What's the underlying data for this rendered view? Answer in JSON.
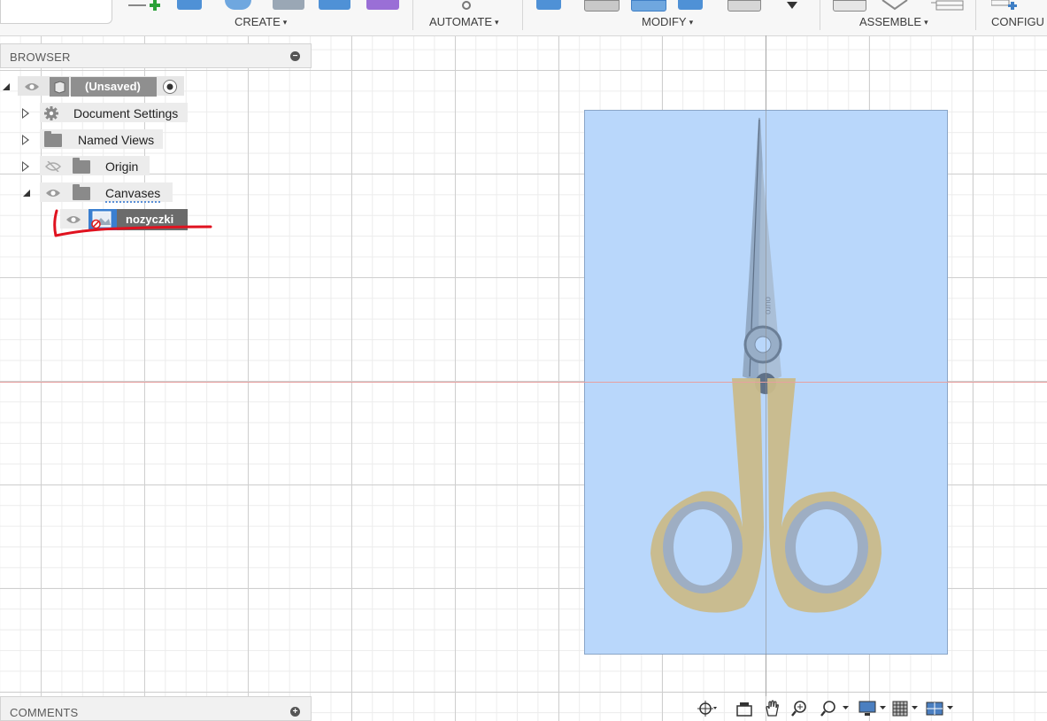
{
  "toolbar": {
    "groups": [
      {
        "label": "CREATE"
      },
      {
        "label": "AUTOMATE"
      },
      {
        "label": "MODIFY"
      },
      {
        "label": "ASSEMBLE"
      },
      {
        "label": "CONFIGU"
      }
    ],
    "caret": "▾"
  },
  "browser": {
    "title": "BROWSER",
    "collapse_symbol": "−",
    "root": {
      "label": "(Unsaved)"
    },
    "items": [
      {
        "label": "Document Settings",
        "icon": "gear-icon"
      },
      {
        "label": "Named Views",
        "icon": "folder-icon"
      },
      {
        "label": "Origin",
        "icon": "folder-icon"
      },
      {
        "label": "Canvases",
        "icon": "folder-icon"
      }
    ],
    "canvas_child": {
      "label": "nozyczki"
    }
  },
  "comments": {
    "title": "COMMENTS",
    "expand_symbol": "+"
  },
  "colors": {
    "canvas_fill": "#b9d7fb",
    "selected_node": "#6b6b6b",
    "annotation_red": "#e0121f",
    "scissor_handle": "#c9bb8a"
  },
  "navbar": {
    "icons": [
      "orbit-icon",
      "look-at-icon",
      "pan-icon",
      "zoom-window-icon",
      "zoom-icon",
      "display-settings-icon",
      "grid-settings-icon",
      "viewports-icon"
    ]
  }
}
